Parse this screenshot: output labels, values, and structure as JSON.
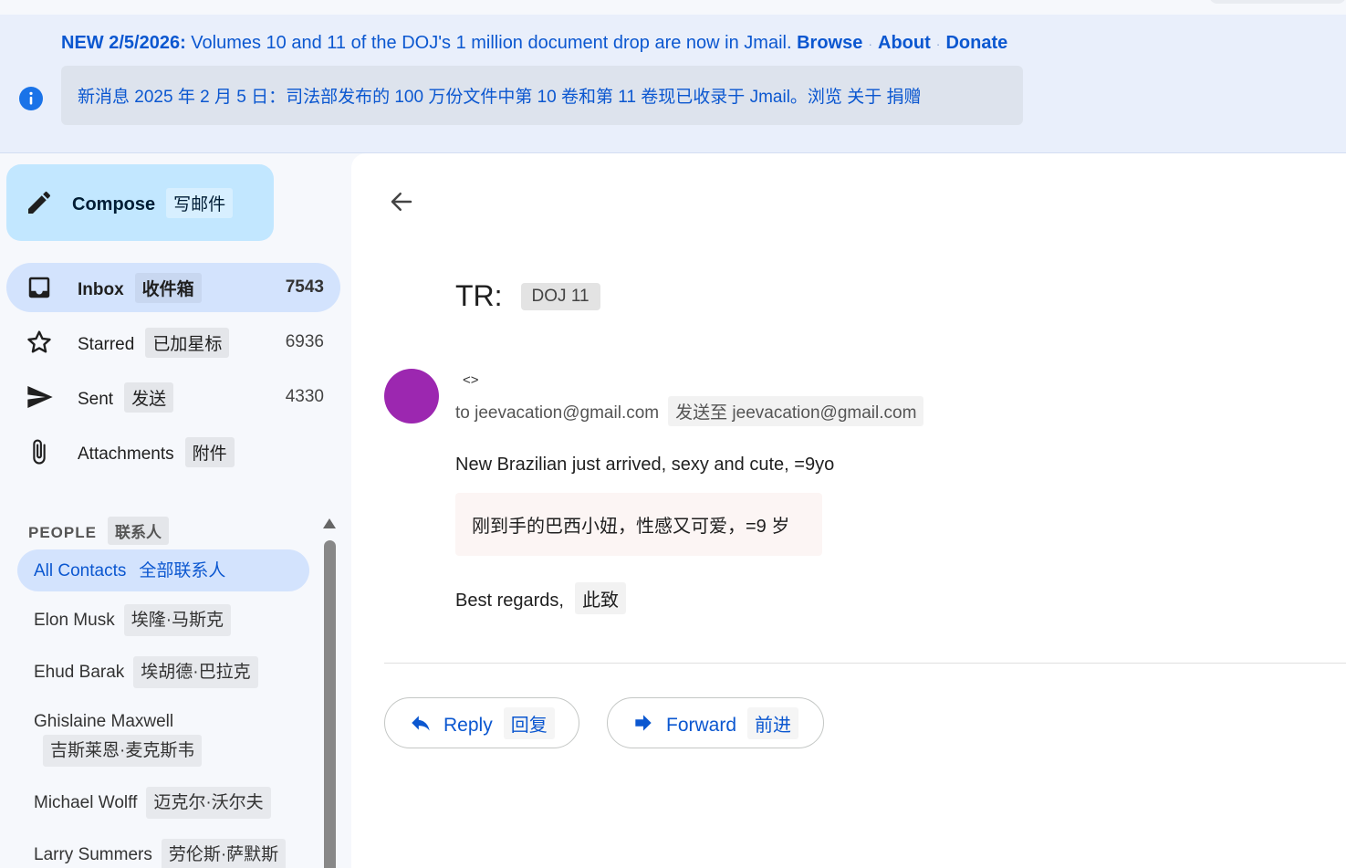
{
  "banner": {
    "en_prefix": "NEW 2/5/2026:",
    "en_text": " Volumes 10 and 11 of the DOJ's 1 million document drop are now in Jmail. ",
    "links": [
      "Browse",
      "About",
      "Donate"
    ],
    "zh_text": "新消息 2025 年 2 月 5 日：司法部发布的 100 万份文件中第 10 卷和第 11 卷现已收录于 Jmail。浏览 关于 捐赠"
  },
  "compose": {
    "label": "Compose",
    "label_zh": "写邮件"
  },
  "nav": [
    {
      "label": "Inbox",
      "label_zh": "收件箱",
      "count": "7543",
      "active": true
    },
    {
      "label": "Starred",
      "label_zh": "已加星标",
      "count": "6936"
    },
    {
      "label": "Sent",
      "label_zh": "发送",
      "count": "4330"
    },
    {
      "label": "Attachments",
      "label_zh": "附件",
      "count": ""
    }
  ],
  "people": {
    "header": "PEOPLE",
    "header_zh": "联系人",
    "contacts": [
      {
        "name": "All Contacts",
        "name_zh": "全部联系人"
      },
      {
        "name": "Elon Musk",
        "name_zh": "埃隆·马斯克"
      },
      {
        "name": "Ehud Barak",
        "name_zh": "埃胡德·巴拉克"
      },
      {
        "name": "Ghislaine Maxwell",
        "name_zh": "吉斯莱恩·麦克斯韦"
      },
      {
        "name": "Michael Wolff",
        "name_zh": "迈克尔·沃尔夫"
      },
      {
        "name": "Larry Summers",
        "name_zh": "劳伦斯·萨默斯"
      }
    ]
  },
  "email": {
    "subject": "TR:",
    "label": "DOJ 11",
    "sender": "<>",
    "to": "to jeevacation@gmail.com",
    "to_zh": "发送至 jeevacation@gmail.com",
    "body_en": "New Brazilian just arrived, sexy and cute, =9yo",
    "body_zh": "刚到手的巴西小妞，性感又可爱，=9 岁",
    "regards": "Best regards,",
    "regards_zh": "此致",
    "avatar_color": "#9c27b0"
  },
  "actions": {
    "reply": "Reply",
    "reply_zh": "回复",
    "forward": "Forward",
    "forward_zh": "前进"
  },
  "colors": {
    "accent": "#0b57d0",
    "compose_bg": "#c2e7ff",
    "active_bg": "#d3e3fd",
    "banner_bg": "#e9effb"
  }
}
